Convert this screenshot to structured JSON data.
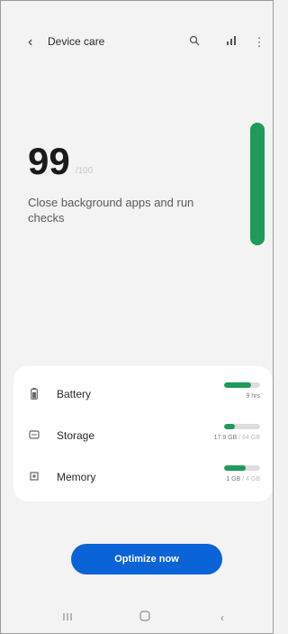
{
  "header": {
    "back_icon": "chevron-left-icon",
    "title": "Device care",
    "search_icon": "search-icon",
    "signal_icon": "bar-chart-icon",
    "more_icon": "more-vertical-icon"
  },
  "summary": {
    "score": "99",
    "score_unit": "/100",
    "description": "Close background apps and run checks",
    "level_fraction": 0.99,
    "accent_color": "#1e9a5b"
  },
  "items": [
    {
      "icon": "battery-icon",
      "label": "Battery",
      "value": "9 hrs",
      "value_muted": "",
      "fill": 0.75
    },
    {
      "icon": "storage-icon",
      "label": "Storage",
      "value": "17.9 GB",
      "value_muted": "/ 64 GB",
      "fill": 0.3
    },
    {
      "icon": "memory-icon",
      "label": "Memory",
      "value": "1 GB",
      "value_muted": "/ 4 GB",
      "fill": 0.6
    }
  ],
  "optimize_button": {
    "label": "Optimize now",
    "color": "#0b63d8"
  },
  "navbar": {
    "recents_icon": "recents-icon",
    "home_icon": "home-icon",
    "back_icon": "back-icon"
  }
}
